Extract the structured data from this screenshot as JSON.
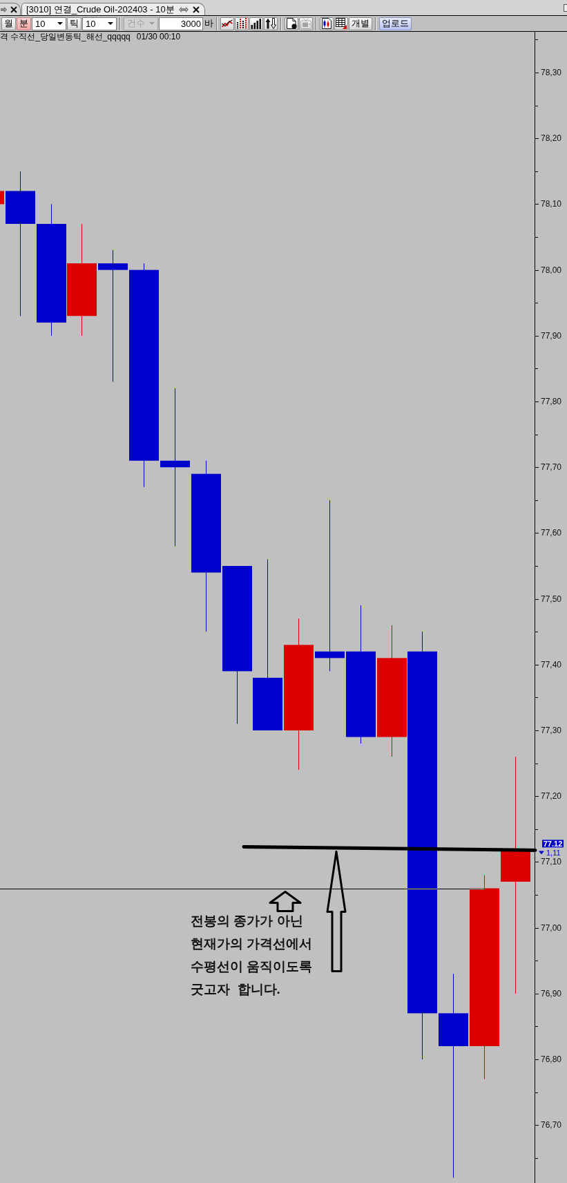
{
  "tabs": [
    {
      "selected": false
    },
    {
      "title": "[3010] 연결_Crude Oil-202403 - 10분",
      "selected": true
    }
  ],
  "toolbar": {
    "groups": [
      [
        {
          "kind": "toggle",
          "label": "월",
          "selected": false
        },
        {
          "kind": "toggle",
          "label": "분",
          "selected": true
        },
        {
          "kind": "dropdown",
          "value": "10",
          "disabled": false
        },
        {
          "kind": "toggle",
          "label": "틱",
          "selected": false
        },
        {
          "kind": "dropdown",
          "value": "10",
          "disabled": false
        }
      ],
      [
        {
          "kind": "dropdown",
          "value": "건수",
          "disabled": true
        },
        {
          "kind": "input",
          "value": "3000"
        },
        {
          "kind": "unit",
          "label": "바"
        }
      ],
      [
        {
          "kind": "icon",
          "disabled": false
        },
        {
          "kind": "icon",
          "disabled": false
        },
        {
          "kind": "icon",
          "disabled": false
        },
        {
          "kind": "icon",
          "disabled": false
        }
      ],
      [
        {
          "kind": "icon",
          "disabled": false
        },
        {
          "kind": "icon",
          "disabled": true
        }
      ],
      [
        {
          "kind": "icon",
          "disabled": false
        },
        {
          "kind": "icon",
          "disabled": false
        },
        {
          "kind": "button",
          "label": "개별",
          "primary": false
        }
      ],
      [
        {
          "kind": "button",
          "label": "업로드",
          "primary": true
        }
      ]
    ]
  },
  "chart": {
    "legend": "격 수직선_당일변동틱_해선_qqqqq",
    "timestamp": "01/30 00:10",
    "axis_labels": [
      "78,30",
      "78,20",
      "78,10",
      "78,00",
      "77,90",
      "77,80",
      "77,70",
      "77,60",
      "77,50",
      "77,40",
      "77,30",
      "77,20",
      "77,10",
      "77,00",
      "76,90",
      "76,80",
      "76,70"
    ],
    "price_tag": {
      "value": "77.12",
      "change": "1,11",
      "down": true
    },
    "note": "전봉의 종가가 아닌\n현재가의 가격선에서\n수평선이 움직이도록\n굿고자  합니다."
  }
}
